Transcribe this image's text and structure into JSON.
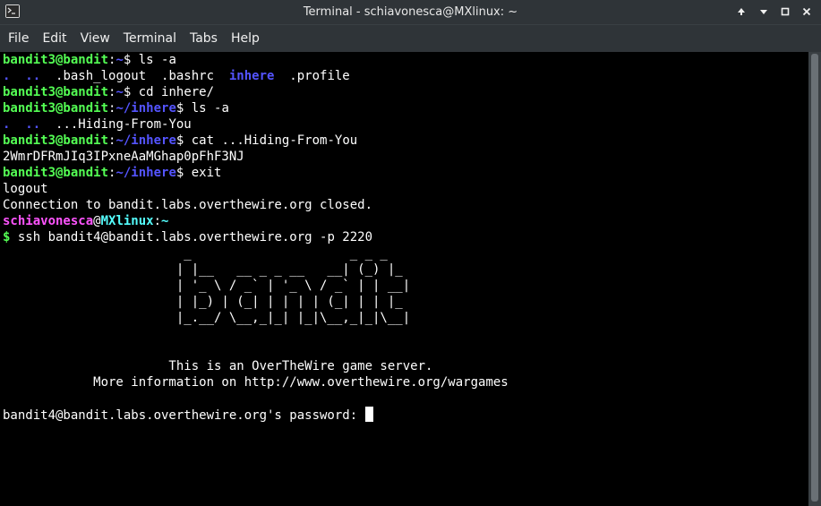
{
  "window": {
    "title": "Terminal - schiavonesca@MXlinux: ~"
  },
  "menu": [
    "File",
    "Edit",
    "View",
    "Terminal",
    "Tabs",
    "Help"
  ],
  "lines": [
    [
      {
        "t": "bandit3@bandit",
        "c": "g"
      },
      {
        "t": ":",
        "c": ""
      },
      {
        "t": "~",
        "c": "b"
      },
      {
        "t": "$ ls -a",
        "c": ""
      }
    ],
    [
      {
        "t": ".  ..",
        "c": "b"
      },
      {
        "t": "  .bash_logout  .bashrc  ",
        "c": ""
      },
      {
        "t": "inhere",
        "c": "b"
      },
      {
        "t": "  .profile",
        "c": ""
      }
    ],
    [
      {
        "t": "bandit3@bandit",
        "c": "g"
      },
      {
        "t": ":",
        "c": ""
      },
      {
        "t": "~",
        "c": "b"
      },
      {
        "t": "$ cd inhere/",
        "c": ""
      }
    ],
    [
      {
        "t": "bandit3@bandit",
        "c": "g"
      },
      {
        "t": ":",
        "c": ""
      },
      {
        "t": "~/inhere",
        "c": "b"
      },
      {
        "t": "$ ls -a",
        "c": ""
      }
    ],
    [
      {
        "t": ".  ..",
        "c": "b"
      },
      {
        "t": "  ...Hiding-From-You",
        "c": ""
      }
    ],
    [
      {
        "t": "bandit3@bandit",
        "c": "g"
      },
      {
        "t": ":",
        "c": ""
      },
      {
        "t": "~/inhere",
        "c": "b"
      },
      {
        "t": "$ cat ...Hiding-From-You",
        "c": ""
      }
    ],
    [
      {
        "t": "2WmrDFRmJIq3IPxneAaMGhap0pFhF3NJ",
        "c": ""
      }
    ],
    [
      {
        "t": "bandit3@bandit",
        "c": "g"
      },
      {
        "t": ":",
        "c": ""
      },
      {
        "t": "~/inhere",
        "c": "b"
      },
      {
        "t": "$ exit",
        "c": ""
      }
    ],
    [
      {
        "t": "logout",
        "c": ""
      }
    ],
    [
      {
        "t": "Connection to bandit.labs.overthewire.org closed.",
        "c": ""
      }
    ],
    [
      {
        "t": "schiavonesca",
        "c": "m"
      },
      {
        "t": "@",
        "c": ""
      },
      {
        "t": "MXlinux",
        "c": "c"
      },
      {
        "t": ":",
        "c": ""
      },
      {
        "t": "~",
        "c": "c"
      }
    ],
    [
      {
        "t": "$",
        "c": "g"
      },
      {
        "t": " ssh bandit4@bandit.labs.overthewire.org -p 2220",
        "c": ""
      }
    ],
    [
      {
        "t": "                        _                     _ _ _   ",
        "c": ""
      }
    ],
    [
      {
        "t": "                       | |__   __ _ _ __   __| (_) |_ ",
        "c": ""
      }
    ],
    [
      {
        "t": "                       | '_ \\ / _` | '_ \\ / _` | | __|",
        "c": ""
      }
    ],
    [
      {
        "t": "                       | |_) | (_| | | | | (_| | | |_ ",
        "c": ""
      }
    ],
    [
      {
        "t": "                       |_.__/ \\__,_|_| |_|\\__,_|_|\\__|",
        "c": ""
      }
    ],
    [
      {
        "t": "",
        "c": ""
      }
    ],
    [
      {
        "t": "",
        "c": ""
      }
    ],
    [
      {
        "t": "                      This is an OverTheWire game server.",
        "c": ""
      }
    ],
    [
      {
        "t": "            More information on http://www.overthewire.org/wargames",
        "c": ""
      }
    ],
    [
      {
        "t": "",
        "c": ""
      }
    ],
    [
      {
        "t": "bandit4@bandit.labs.overthewire.org's password: ",
        "c": ""
      }
    ]
  ]
}
